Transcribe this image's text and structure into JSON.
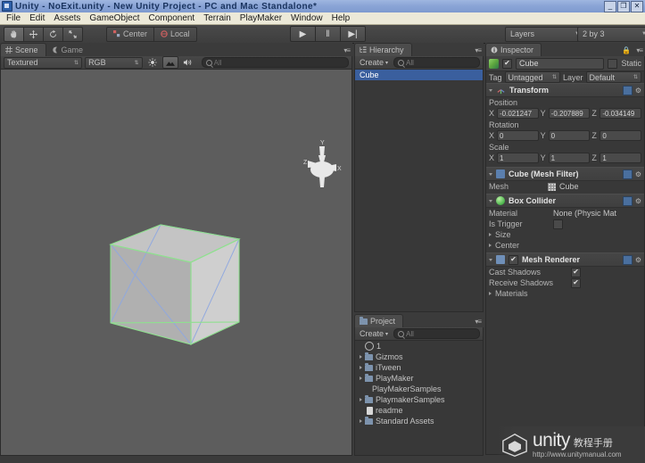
{
  "window": {
    "title": "Unity - NoExit.unity - New Unity Project - PC and Mac Standalone*",
    "minimize": "_",
    "restore": "❐",
    "close": "✕",
    "app_icon": "unity-app-icon"
  },
  "menubar": {
    "items": [
      "File",
      "Edit",
      "Assets",
      "GameObject",
      "Component",
      "Terrain",
      "PlayMaker",
      "Window",
      "Help"
    ]
  },
  "toolbar": {
    "transform_tools": [
      {
        "name": "hand-tool",
        "glyph": "✋",
        "active": true
      },
      {
        "name": "move-tool",
        "glyph": "✥",
        "active": false
      },
      {
        "name": "rotate-tool",
        "glyph": "↻",
        "active": false
      },
      {
        "name": "scale-tool",
        "glyph": "⛶",
        "active": false
      }
    ],
    "pivot_mode": "Center",
    "pivot_rotation": "Local",
    "play": "▶",
    "pause": "‖",
    "step": "▶|",
    "layers_label": "Layers",
    "layout_label": "2 by 3",
    "dropdown_arrow": "▼"
  },
  "scene": {
    "tabs": [
      {
        "label": "Scene",
        "icon": "grid-icon",
        "active": true
      },
      {
        "label": "Game",
        "icon": "game-icon",
        "active": false
      }
    ],
    "draw_mode": "Textured",
    "render_mode": "RGB",
    "toggles": [
      {
        "name": "lighting-toggle",
        "glyph": "☀",
        "on": false
      },
      {
        "name": "fx-toggle",
        "glyph": "⛰",
        "on": true
      },
      {
        "name": "audio-toggle",
        "glyph": "◂)",
        "on": false
      }
    ],
    "search_placeholder": "All",
    "gizmo_axes": {
      "y": "Y",
      "x": "X",
      "z": "Z"
    },
    "object_color": "#c8c8c8",
    "collider_color": "#8fe08f",
    "wire_color": "#8fa8e0"
  },
  "hierarchy": {
    "tab_label": "Hierarchy",
    "create_label": "Create",
    "create_arrow": "▾",
    "search_placeholder": "All",
    "items": [
      {
        "label": "Cube",
        "selected": true
      }
    ]
  },
  "project": {
    "tab_label": "Project",
    "create_label": "Create",
    "create_arrow": "▾",
    "search_placeholder": "All",
    "items": [
      {
        "label": "1",
        "icon": "unity-icon",
        "expandable": false,
        "indent": 0
      },
      {
        "label": "Gizmos",
        "icon": "folder-icon",
        "expandable": true,
        "indent": 0
      },
      {
        "label": "iTween",
        "icon": "folder-icon",
        "expandable": true,
        "indent": 0
      },
      {
        "label": "PlayMaker",
        "icon": "folder-icon",
        "expandable": true,
        "indent": 0
      },
      {
        "label": "PlayMakerSamples",
        "icon": "none",
        "expandable": false,
        "indent": 1
      },
      {
        "label": "PlaymakerSamples",
        "icon": "folder-icon",
        "expandable": true,
        "indent": 0
      },
      {
        "label": "readme",
        "icon": "document-icon",
        "expandable": false,
        "indent": 0
      },
      {
        "label": "Standard Assets",
        "icon": "folder-icon",
        "expandable": true,
        "indent": 0
      }
    ]
  },
  "inspector": {
    "tab_label": "Inspector",
    "lock_icon": "ὑ2",
    "object": {
      "enabled": true,
      "check_glyph": "✔",
      "name": "Cube",
      "static_label": "Static",
      "static_checked": false,
      "tag_label": "Tag",
      "tag_value": "Untagged",
      "layer_label": "Layer",
      "layer_value": "Default"
    },
    "components": [
      {
        "name": "Transform",
        "icon": "transform-icon",
        "expanded": true,
        "groups": [
          {
            "label": "Position",
            "fields": [
              {
                "axis": "X",
                "value": "-0.021247"
              },
              {
                "axis": "Y",
                "value": "-0.207889"
              },
              {
                "axis": "Z",
                "value": "-0.034149"
              }
            ]
          },
          {
            "label": "Rotation",
            "fields": [
              {
                "axis": "X",
                "value": "0"
              },
              {
                "axis": "Y",
                "value": "0"
              },
              {
                "axis": "Z",
                "value": "0"
              }
            ]
          },
          {
            "label": "Scale",
            "fields": [
              {
                "axis": "X",
                "value": "1"
              },
              {
                "axis": "Y",
                "value": "1"
              },
              {
                "axis": "Z",
                "value": "1"
              }
            ]
          }
        ]
      },
      {
        "name": "Cube (Mesh Filter)",
        "icon": "mesh-filter-icon",
        "expanded": true,
        "rows": [
          {
            "label": "Mesh",
            "value": "Cube",
            "type": "object-field"
          }
        ]
      },
      {
        "name": "Box Collider",
        "icon": "box-collider-icon",
        "expanded": true,
        "rows": [
          {
            "label": "Material",
            "value": "None (Physic Mat",
            "type": "object-field"
          },
          {
            "label": "Is Trigger",
            "value": "",
            "type": "checkbox",
            "checked": false
          },
          {
            "label": "Size",
            "value": "",
            "type": "foldout"
          },
          {
            "label": "Center",
            "value": "",
            "type": "foldout"
          }
        ]
      },
      {
        "name": "Mesh Renderer",
        "icon": "mesh-renderer-icon",
        "expanded": true,
        "enabled": true,
        "check_glyph": "✔",
        "rows": [
          {
            "label": "Cast Shadows",
            "value": "",
            "type": "checkbox",
            "checked": true
          },
          {
            "label": "Receive Shadows",
            "value": "",
            "type": "checkbox",
            "checked": true
          },
          {
            "label": "Materials",
            "value": "",
            "type": "foldout"
          }
        ]
      }
    ]
  },
  "watermark": {
    "brand": "unity",
    "subtitle": "教程手册",
    "url": "http://www.unitymanual.com"
  }
}
